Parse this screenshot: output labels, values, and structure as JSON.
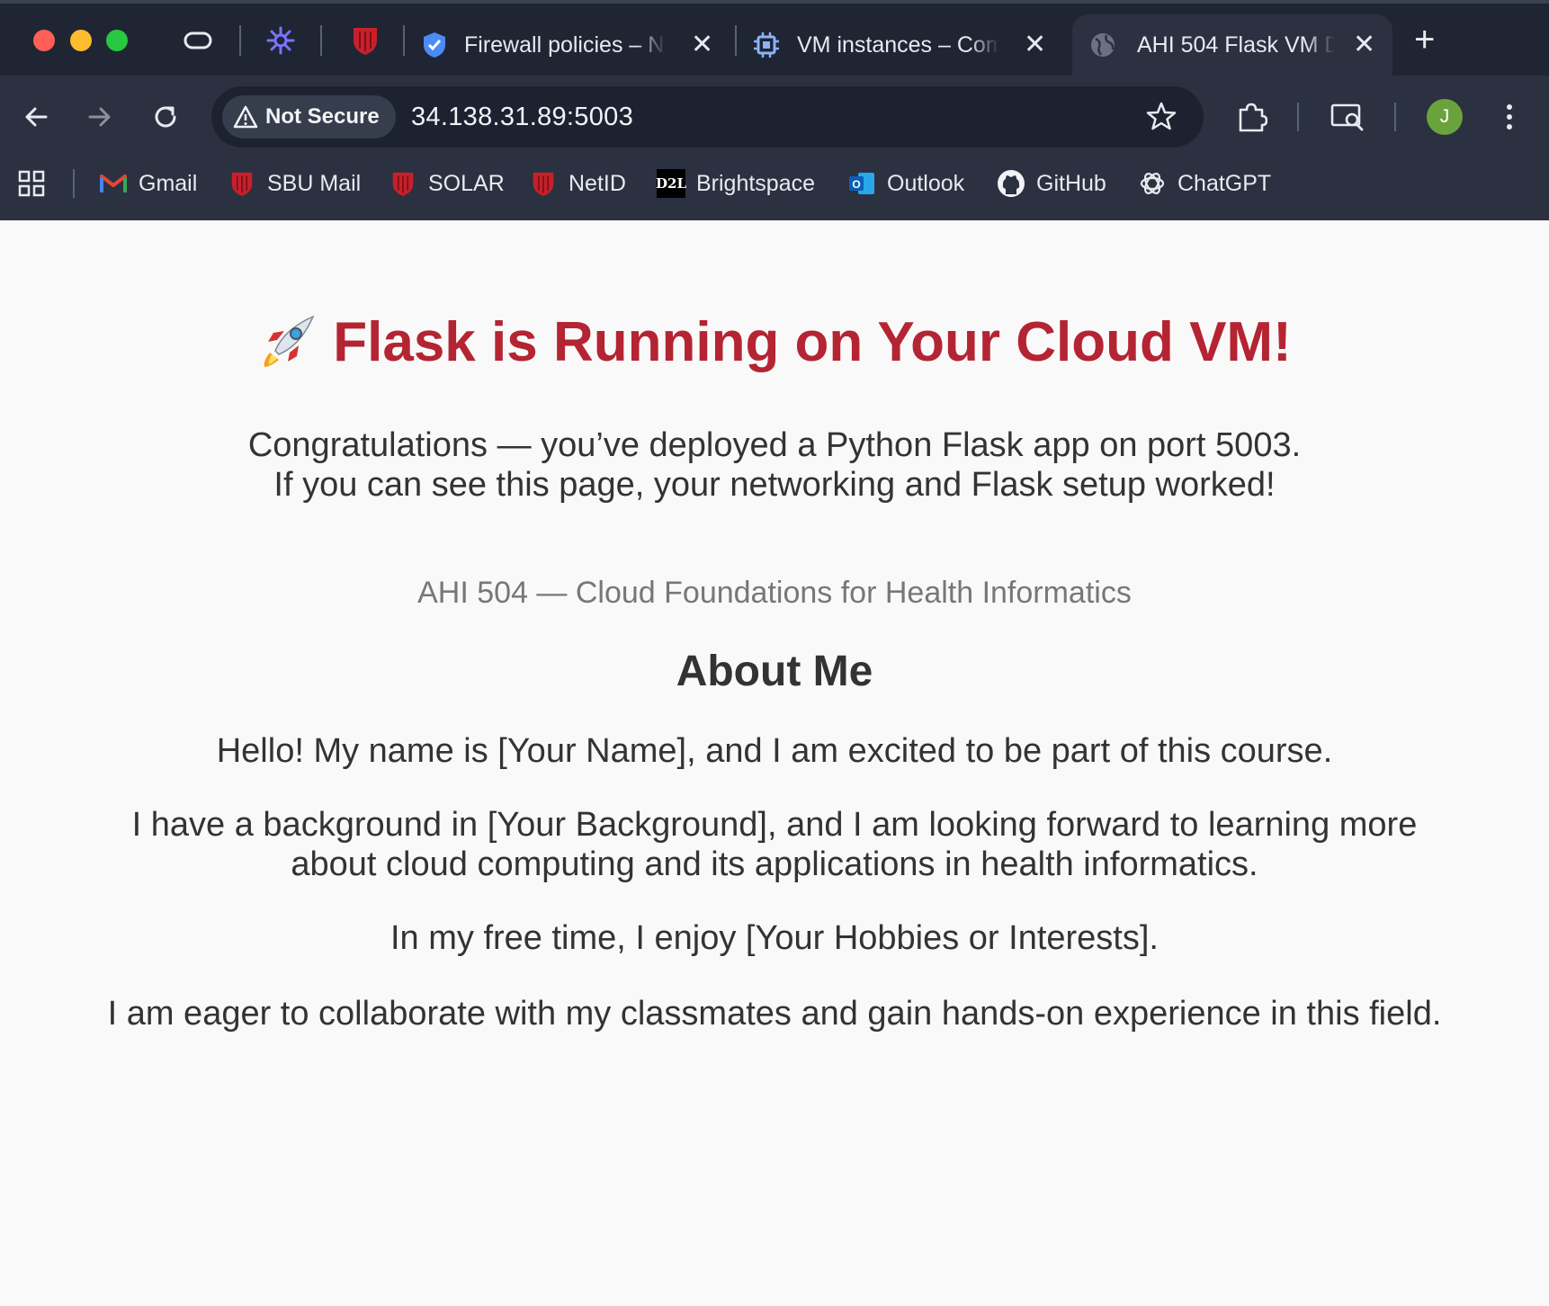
{
  "browser": {
    "tabs": [
      {
        "title": "Firewall policies – N",
        "icon": "shield-icon"
      },
      {
        "title": "VM instances – Com",
        "icon": "chip-icon"
      },
      {
        "title": "AHI 504 Flask VM D",
        "icon": "globe-icon",
        "active": true
      }
    ],
    "security_label": "Not Secure",
    "url": "34.138.31.89:5003",
    "avatar_initial": "J",
    "avatar_color": "#6aa33b",
    "bookmarks": [
      {
        "label": "Gmail",
        "icon": "gmail-icon"
      },
      {
        "label": "SBU Mail",
        "icon": "sbu-shield-icon"
      },
      {
        "label": "SOLAR",
        "icon": "sbu-shield-icon"
      },
      {
        "label": "NetID",
        "icon": "sbu-shield-icon"
      },
      {
        "label": "Brightspace",
        "icon": "d2l-icon"
      },
      {
        "label": "Outlook",
        "icon": "outlook-icon"
      },
      {
        "label": "GitHub",
        "icon": "github-icon"
      },
      {
        "label": "ChatGPT",
        "icon": "chatgpt-icon"
      }
    ]
  },
  "page": {
    "heading_emoji": "rocket-icon",
    "heading": "Flask is Running on Your Cloud VM!",
    "heading_color": "#b42432",
    "lead_line1": "Congratulations — you’ve deployed a Python Flask app on port 5003.",
    "lead_line2": "If you can see this page, your networking and Flask setup worked!",
    "subtitle": "AHI 504 — Cloud Foundations for Health Informatics",
    "about_title": "About Me",
    "about_paragraphs": [
      "Hello! My name is [Your Name], and I am excited to be part of this course.",
      "I have a background in [Your Background], and I am looking forward to learning more about cloud computing and its applications in health informatics.",
      "In my free time, I enjoy [Your Hobbies or Interests].",
      "I am eager to collaborate with my classmates and gain hands-on experience in this field."
    ]
  }
}
